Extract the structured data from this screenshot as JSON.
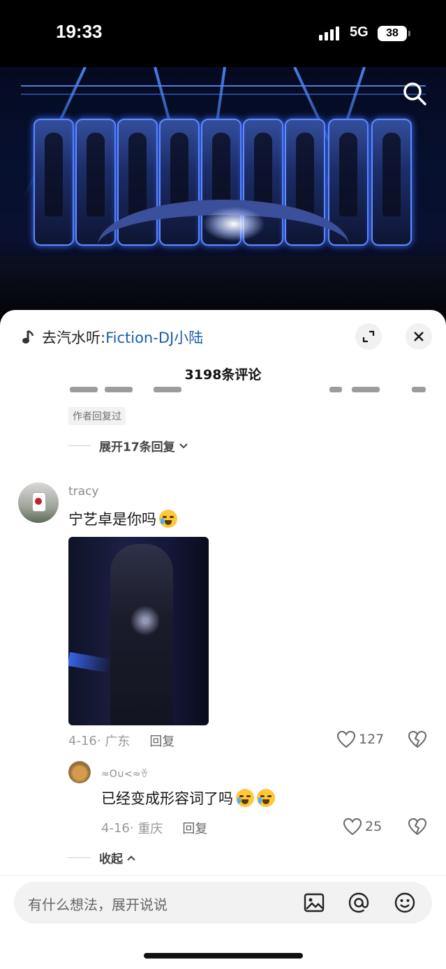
{
  "status_bar": {
    "time": "19:33",
    "network": "5G",
    "battery": "38"
  },
  "music": {
    "prefix": "去汽水听:",
    "song": "Fiction-DJ小陆"
  },
  "comments_header": {
    "title": "3198条评论"
  },
  "previous_thread": {
    "author_tag": "作者回复过",
    "expand_label": "展开17条回复"
  },
  "comment": {
    "username": "tracy",
    "text": "宁艺卓是你吗",
    "date": "4-16",
    "location": "广东",
    "reply_label": "回复",
    "likes": "127"
  },
  "reply": {
    "username": "≈O∪<≈ꈊ",
    "text": "已经变成形容词了吗",
    "date": "4-16",
    "location": "重庆",
    "reply_label": "回复",
    "likes": "25"
  },
  "collapse_label": "收起",
  "input": {
    "placeholder": "有什么想法，展开说说"
  },
  "icons": [
    "search-icon",
    "music-note-icon",
    "expand-icon",
    "close-icon",
    "chevron-down-icon",
    "chevron-up-icon",
    "heart-icon",
    "broken-heart-icon",
    "image-icon",
    "at-icon",
    "emoji-icon"
  ],
  "colors": {
    "link_blue": "#1a5ea8",
    "sheet_bg": "#ffffff"
  }
}
